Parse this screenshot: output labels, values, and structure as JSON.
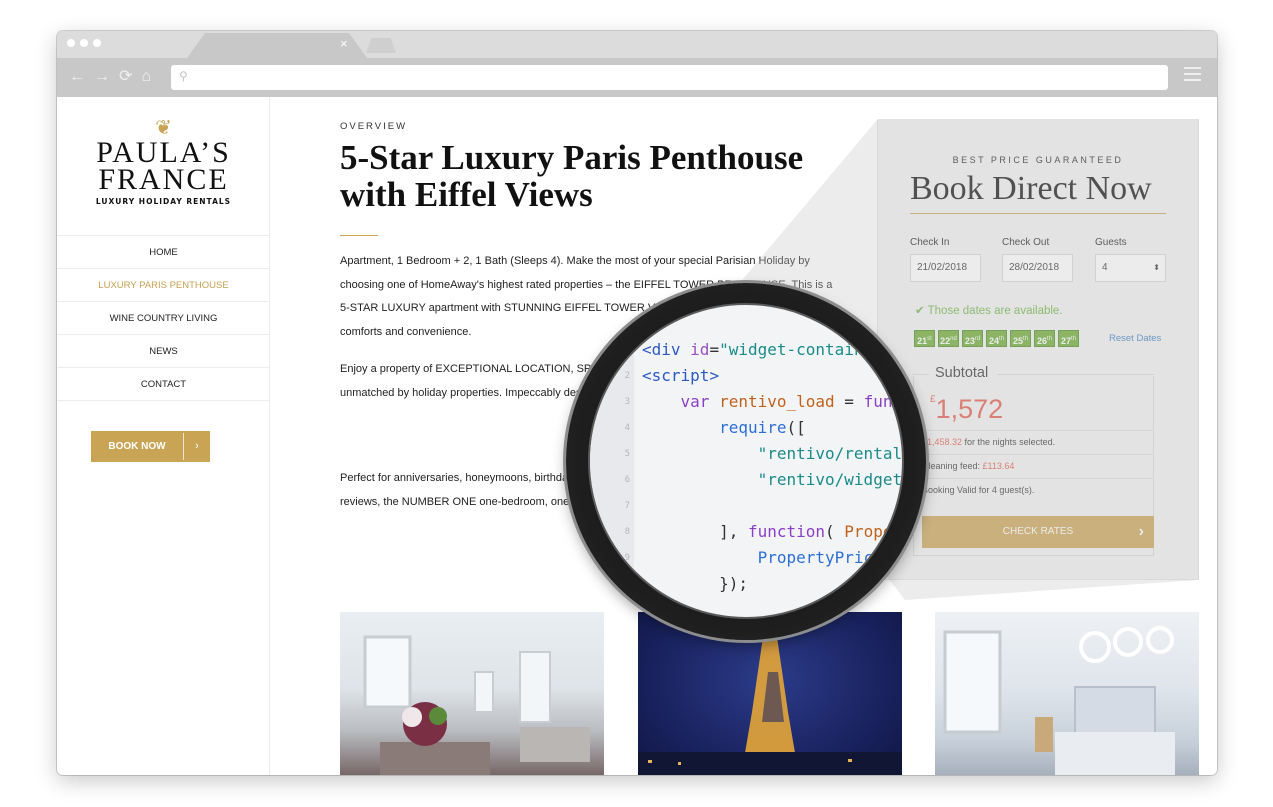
{
  "browser": {
    "tab_close": "×",
    "nav": {
      "back": "←",
      "forward": "→",
      "reload": "⟳",
      "home": "⌂"
    },
    "search_glyph": "⚲"
  },
  "sidebar": {
    "logo": {
      "ornament": "❦",
      "line1": "PAULA’S",
      "line2": "FRANCE",
      "tagline": "LUXURY HOLIDAY RENTALS"
    },
    "menu": [
      {
        "label": "HOME",
        "active": false
      },
      {
        "label": "LUXURY PARIS PENTHOUSE",
        "active": true
      },
      {
        "label": "WINE COUNTRY LIVING",
        "active": false
      },
      {
        "label": "NEWS",
        "active": false
      },
      {
        "label": "CONTACT",
        "active": false
      }
    ],
    "book_now": {
      "label": "BOOK NOW",
      "arrow": "›"
    }
  },
  "main": {
    "kicker": "OVERVIEW",
    "title": "5-Star Luxury Paris Penthouse with Eiffel Views",
    "paragraphs": [
      "Apartment, 1 Bedroom + 2, 1 Bath (Sleeps 4). Make the most of your special Parisian Holiday by choosing one of HomeAway's highest rated properties – the EIFFEL TOWER PENTHOUSE. This is a 5-STAR LUXURY apartment with STUNNING EIFFEL TOWER VIEWS and complimentary amenities, comforts and convenience.",
      "Enjoy a property of EXCEPTIONAL LOCATION, SPACE, and VALUE for your travel dollars that's unmatched by holiday properties. Impeccably designed, furnished LUXURY ACCOMMODATION.",
      "Perfect for anniversaries, honeymoons, birthdays FIVE-STAR HOTEL with 4x more space at less reviews, the NUMBER ONE one-bedroom, one among the TOP 20 of all the 5000+ Paris apartments"
    ]
  },
  "widget": {
    "kicker": "BEST PRICE GUARANTEED",
    "title": "Book Direct Now",
    "check_in": {
      "label": "Check In",
      "value": "21/02/2018"
    },
    "check_out": {
      "label": "Check Out",
      "value": "28/02/2018"
    },
    "guests": {
      "label": "Guests",
      "value": "4"
    },
    "availability": "✔ Those dates are available.",
    "days": [
      {
        "num": "21",
        "suf": "st"
      },
      {
        "num": "22",
        "suf": "nd"
      },
      {
        "num": "23",
        "suf": "rd"
      },
      {
        "num": "24",
        "suf": "th"
      },
      {
        "num": "25",
        "suf": "th"
      },
      {
        "num": "26",
        "suf": "th"
      },
      {
        "num": "27",
        "suf": "th"
      }
    ],
    "reset": "Reset Dates",
    "subtotal_label": "Subtotal",
    "currency": "£",
    "total": "1,572",
    "nights_amount": "£1,458.32",
    "nights_text": " for the nights selected.",
    "cleaning_text": "Cleaning feed: ",
    "cleaning_amount": "£113.64",
    "valid_text": "Booking Valid for 4 guest(s).",
    "check_rates": "CHECK RATES",
    "check_arrow": "›"
  },
  "code_lines": [
    {
      "n": "",
      "parts": [
        [
          "tag",
          "<div "
        ],
        [
          "attr",
          "id"
        ],
        [
          "pl",
          "="
        ],
        [
          "str",
          "\"widget-contain"
        ]
      ]
    },
    {
      "n": "2",
      "parts": [
        [
          "tag",
          "<script"
        ],
        [
          "tag",
          ">"
        ]
      ]
    },
    {
      "n": "3",
      "parts": [
        [
          "pl",
          "    "
        ],
        [
          "kw",
          "var "
        ],
        [
          "var",
          "rentivo_load"
        ],
        [
          "pl",
          " = "
        ],
        [
          "kw",
          "func"
        ]
      ]
    },
    {
      "n": "4",
      "parts": [
        [
          "pl",
          "        "
        ],
        [
          "fn",
          "require"
        ],
        [
          "pl",
          "(["
        ]
      ]
    },
    {
      "n": "5",
      "parts": [
        [
          "pl",
          "            "
        ],
        [
          "str",
          "\"rentivo/rental"
        ]
      ]
    },
    {
      "n": "6",
      "parts": [
        [
          "pl",
          "            "
        ],
        [
          "str",
          "\"rentivo/widget"
        ]
      ]
    },
    {
      "n": "7",
      "parts": [
        [
          "pl",
          ""
        ]
      ]
    },
    {
      "n": "8",
      "parts": [
        [
          "pl",
          "        ], "
        ],
        [
          "kw",
          "function"
        ],
        [
          "pl",
          "( "
        ],
        [
          "var",
          "Prope"
        ]
      ]
    },
    {
      "n": "9",
      "parts": [
        [
          "pl",
          "            "
        ],
        [
          "fn",
          "PropertyPric"
        ]
      ]
    },
    {
      "n": "",
      "parts": [
        [
          "pl",
          "        });"
        ]
      ]
    }
  ]
}
